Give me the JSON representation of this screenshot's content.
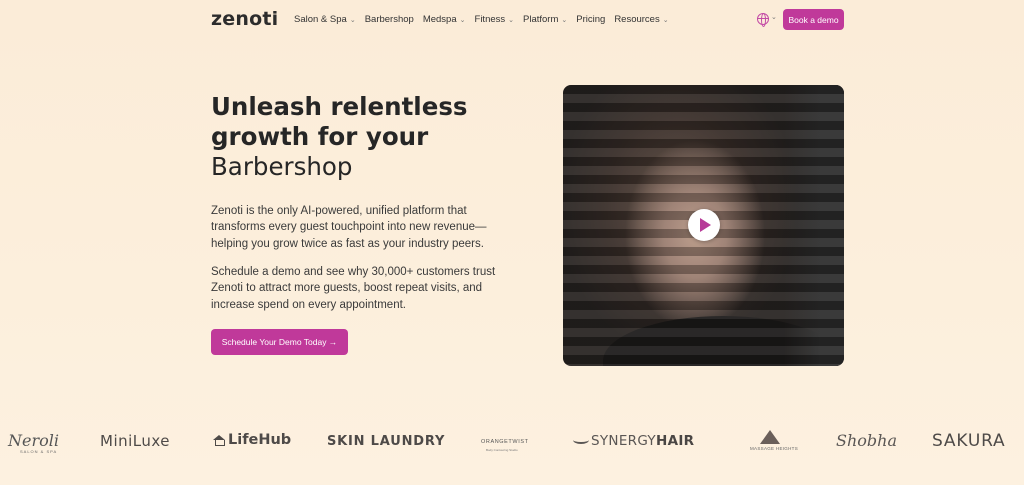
{
  "nav": {
    "logo": "zenoti",
    "menu": [
      {
        "label": "Salon & Spa",
        "has_dropdown": true
      },
      {
        "label": "Barbershop",
        "has_dropdown": false
      },
      {
        "label": "Medspa",
        "has_dropdown": true
      },
      {
        "label": "Fitness",
        "has_dropdown": true
      },
      {
        "label": "Platform",
        "has_dropdown": true
      },
      {
        "label": "Pricing",
        "has_dropdown": false
      },
      {
        "label": "Resources",
        "has_dropdown": true
      }
    ],
    "language_icon": "globe-icon",
    "book_demo_label": "Book a demo"
  },
  "hero": {
    "headline_line1": "Unleash relentless",
    "headline_line2": "growth for your",
    "headline_line3": "Barbershop",
    "paragraph1_line1": "Zenoti is the only AI-powered, unified platform that",
    "paragraph1_line2": "transforms every guest touchpoint into new revenue—",
    "paragraph1_line3": "helping you grow twice as fast as your industry peers.",
    "paragraph2_line1": "Schedule a demo and see why 30,000+ customers trust",
    "paragraph2_line2": "Zenoti to attract more guests, boost repeat visits, and",
    "paragraph2_line3": "increase spend on every appointment.",
    "cta_label": "Schedule Your Demo Today →"
  },
  "video": {
    "play_icon": "play-icon"
  },
  "logos": {
    "neroli": "Neroli",
    "neroli_sub": "SALON & SPA",
    "miniluxe": "MiniLuxe",
    "lifehub": "LifeHub",
    "skin_laundry": "SKIN LAUNDRY",
    "orange_twist": "ORANGETWIST",
    "orange_twist_sub": "Body Contouring Studio",
    "synergy_a": "SYNERGY",
    "synergy_b": "HAIR",
    "massage_heights": "MASSAGE HEIGHTS",
    "shobha": "Shobha",
    "sakura": "SAKURA"
  },
  "colors": {
    "accent": "#c0399a",
    "background": "#fbecd8",
    "text": "#262626"
  }
}
